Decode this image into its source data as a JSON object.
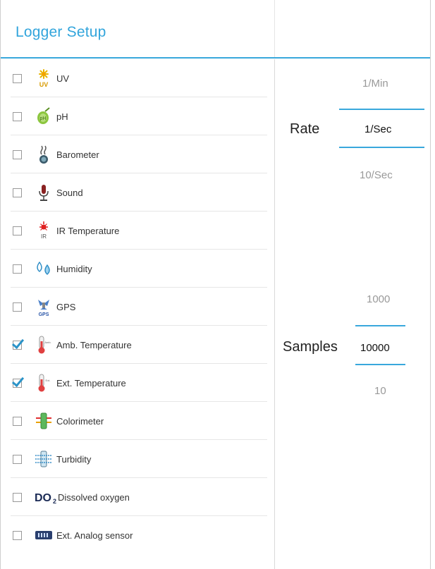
{
  "header": {
    "title": "Logger Setup"
  },
  "sensors": [
    {
      "label": "UV",
      "checked": false,
      "icon": "uv-icon"
    },
    {
      "label": "pH",
      "checked": false,
      "icon": "ph-icon"
    },
    {
      "label": "Barometer",
      "checked": false,
      "icon": "barometer-icon"
    },
    {
      "label": "Sound",
      "checked": false,
      "icon": "microphone-icon"
    },
    {
      "label": "IR Temperature",
      "checked": false,
      "icon": "ir-temperature-icon"
    },
    {
      "label": "Humidity",
      "checked": false,
      "icon": "water-drops-icon"
    },
    {
      "label": "GPS",
      "checked": false,
      "icon": "gps-satellite-icon"
    },
    {
      "label": "Amb. Temperature",
      "checked": true,
      "icon": "thermometer-amb-icon"
    },
    {
      "label": "Ext. Temperature",
      "checked": true,
      "icon": "thermometer-ext-icon"
    },
    {
      "label": "Colorimeter",
      "checked": false,
      "icon": "colorimeter-icon"
    },
    {
      "label": "Turbidity",
      "checked": false,
      "icon": "turbidity-icon"
    },
    {
      "label": "Dissolved oxygen",
      "checked": false,
      "icon": "dissolved-oxygen-icon"
    },
    {
      "label": "Ext. Analog sensor",
      "checked": false,
      "icon": "analog-sensor-icon"
    }
  ],
  "rate": {
    "label": "Rate",
    "prev": "1/Min",
    "selected": "1/Sec",
    "next": "10/Sec"
  },
  "samples": {
    "label": "Samples",
    "prev": "1000",
    "selected": "10000",
    "next": "10"
  },
  "colors": {
    "accent": "#39a8dc",
    "title": "#32a5dc",
    "check": "#2a93c8"
  }
}
